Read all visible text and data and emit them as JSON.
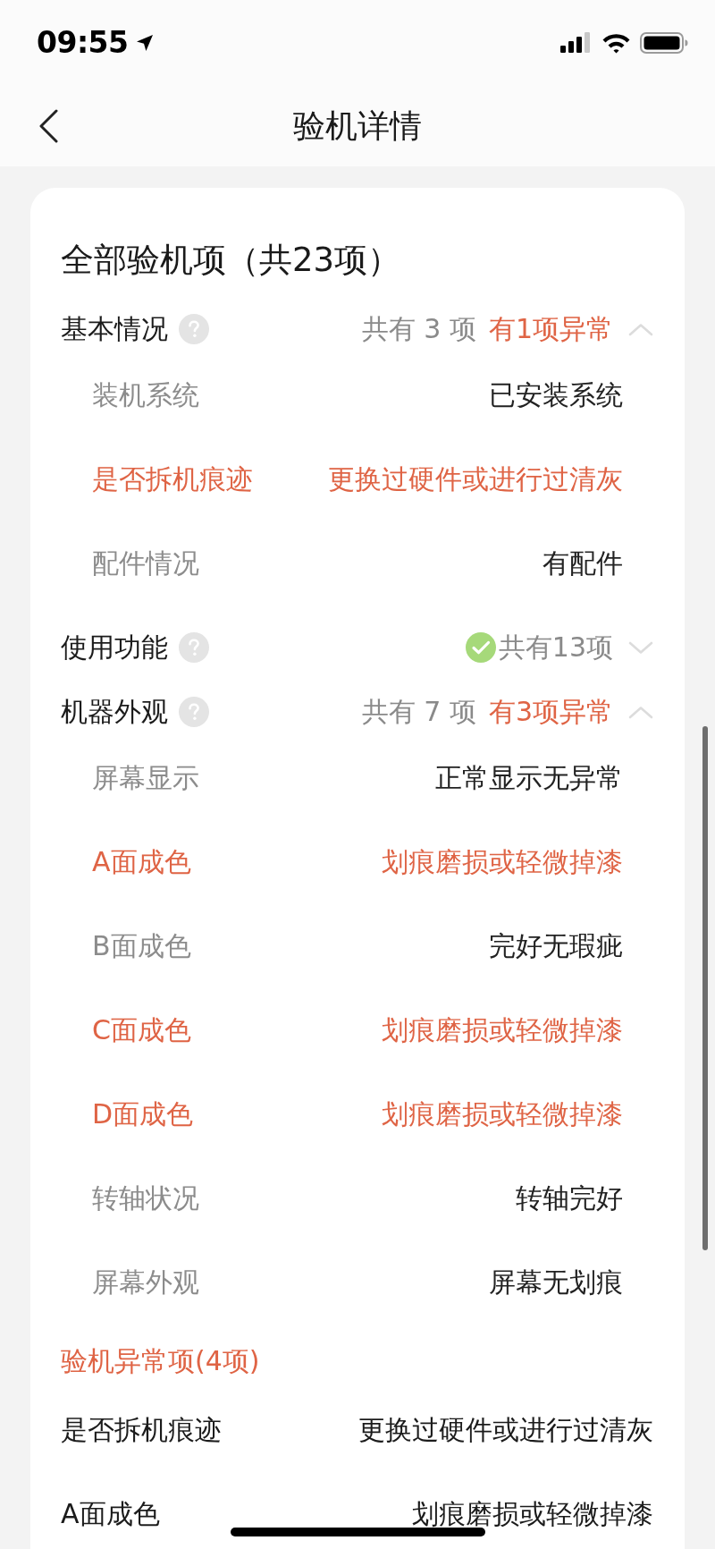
{
  "status_bar": {
    "time": "09:55"
  },
  "nav": {
    "title": "验机详情"
  },
  "card": {
    "title": "全部验机项（共23项）",
    "groups": [
      {
        "name": "基本情况",
        "count": "共有 3 项",
        "abnormal": "有1项异常",
        "passed": false,
        "expanded": true,
        "items": [
          {
            "label": "装机系统",
            "value": "已安装系统",
            "abnormal": false
          },
          {
            "label": "是否拆机痕迹",
            "value": "更换过硬件或进行过清灰",
            "abnormal": true
          },
          {
            "label": "配件情况",
            "value": "有配件",
            "abnormal": false
          }
        ]
      },
      {
        "name": "使用功能",
        "count": "共有13项",
        "passed": true,
        "expanded": false
      },
      {
        "name": "机器外观",
        "count": "共有 7 项",
        "abnormal": "有3项异常",
        "passed": false,
        "expanded": true,
        "items": [
          {
            "label": "屏幕显示",
            "value": "正常显示无异常",
            "abnormal": false
          },
          {
            "label": "A面成色",
            "value": "划痕磨损或轻微掉漆",
            "abnormal": true
          },
          {
            "label": "B面成色",
            "value": "完好无瑕疵",
            "abnormal": false
          },
          {
            "label": "C面成色",
            "value": "划痕磨损或轻微掉漆",
            "abnormal": true
          },
          {
            "label": "D面成色",
            "value": "划痕磨损或轻微掉漆",
            "abnormal": true
          },
          {
            "label": "转轴状况",
            "value": "转轴完好",
            "abnormal": false
          },
          {
            "label": "屏幕外观",
            "value": "屏幕无划痕",
            "abnormal": false
          }
        ]
      }
    ]
  },
  "abnormal_section": {
    "title": "验机异常项(4项)",
    "items": [
      {
        "label": "是否拆机痕迹",
        "value": "更换过硬件或进行过清灰"
      },
      {
        "label": "A面成色",
        "value": "划痕磨损或轻微掉漆"
      }
    ]
  }
}
